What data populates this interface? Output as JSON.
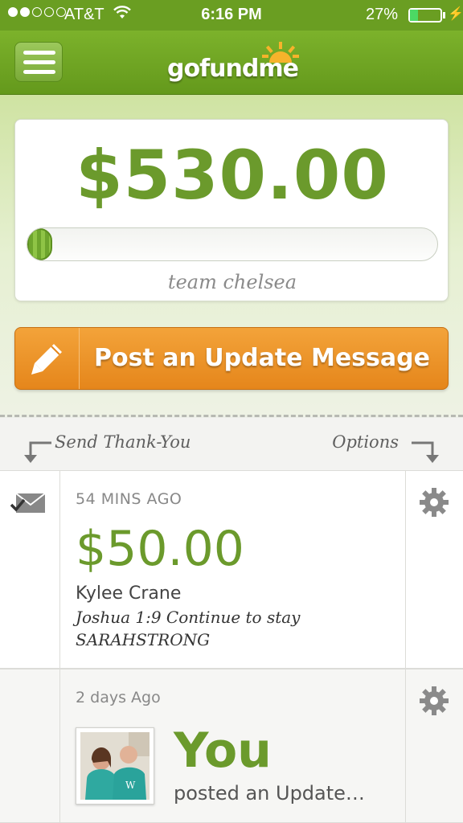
{
  "status_bar": {
    "carrier": "AT&T",
    "time": "6:16 PM",
    "battery": "27%",
    "battery_level": 0.27
  },
  "header": {
    "logo_text": "gofundme"
  },
  "campaign": {
    "amount_raised": "$530.00",
    "progress_fraction": 0.05,
    "team_name": "team chelsea"
  },
  "post_update": {
    "label": "Post an Update Message"
  },
  "feed_hints": {
    "left": "Send Thank-You",
    "right": "Options"
  },
  "feed": [
    {
      "time_ago": "54 MINS AGO",
      "amount": "$50.00",
      "donor": "Kylee Crane",
      "message_line1": "Joshua 1:9 Continue to stay",
      "message_line2": "SARAHSTRONG"
    },
    {
      "time_ago": "2 days Ago",
      "actor": "You",
      "action": "posted an Update…"
    }
  ],
  "colors": {
    "brand_green": "#6b9a2c",
    "action_orange": "#e5861b"
  }
}
